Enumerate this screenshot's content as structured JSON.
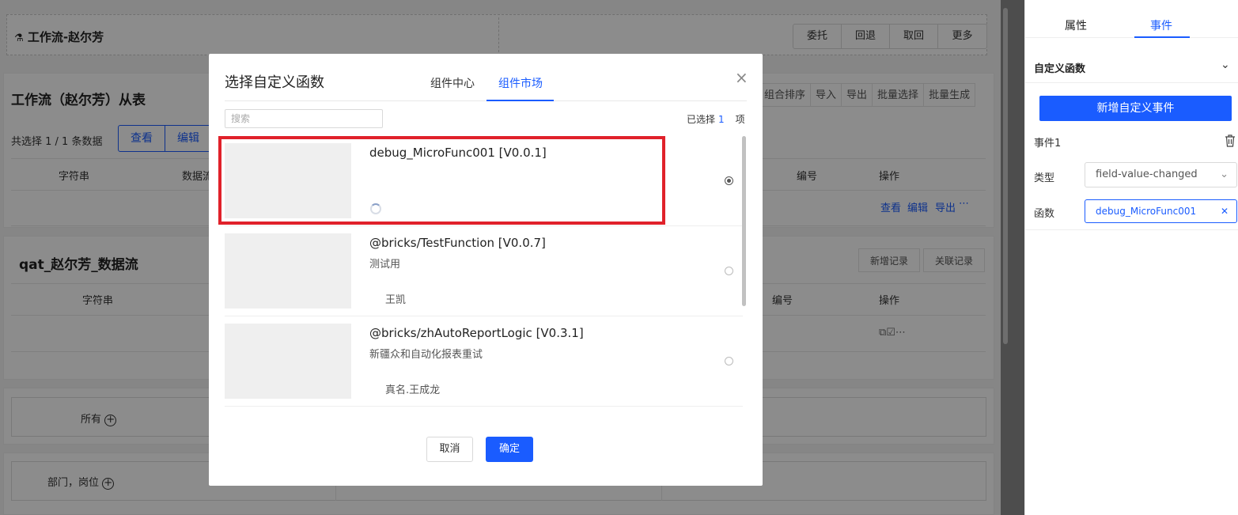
{
  "background": {
    "workflow_title": "工作流-赵尔芳",
    "workflow_buttons": [
      "委托",
      "回退",
      "取回",
      "更多"
    ],
    "section1": {
      "title": "工作流（赵尔芳）从表",
      "selected_text": "共选择 1 / 1 条数据",
      "action_buttons": [
        "查看",
        "编辑"
      ],
      "toolbar": [
        "组合排序",
        "导入",
        "导出",
        "批量选择",
        "批量生成"
      ],
      "columns_left": [
        "字符串",
        "数据流"
      ],
      "columns_right": [
        "编号",
        "操作"
      ],
      "row_actions": [
        "查看",
        "编辑",
        "导出",
        "⋯"
      ]
    },
    "section2": {
      "title": "qat_赵尔芳_数据流",
      "toolbar": [
        "新增记录",
        "关联记录"
      ],
      "columns_left": [
        "字符串"
      ],
      "columns_right": [
        "编号",
        "操作"
      ],
      "row_icons": "⧉☑⋯"
    },
    "filter1": "所有",
    "filter2": "部门，岗位"
  },
  "right_panel": {
    "tabs": [
      "属性",
      "事件"
    ],
    "active_tab": "事件",
    "section_title": "自定义函数",
    "add_button": "新增自定义事件",
    "event_name": "事件1",
    "type_label": "类型",
    "type_value": "field-value-changed",
    "func_label": "函数",
    "func_value": "debug_MicroFunc001"
  },
  "modal": {
    "title": "选择自定义函数",
    "tabs": [
      "组件中心",
      "组件市场"
    ],
    "active_tab": "组件市场",
    "search_placeholder": "搜索",
    "selected_prefix": "已选择",
    "selected_count": "1",
    "selected_suffix": "项",
    "items": [
      {
        "name": "debug_MicroFunc001 [V0.0.1]",
        "desc": "",
        "author": "",
        "selected": true,
        "loading": true
      },
      {
        "name": "@bricks/TestFunction [V0.0.7]",
        "desc": "测试用",
        "author": "王凯",
        "selected": false
      },
      {
        "name": "@bricks/zhAutoReportLogic [V0.3.1]",
        "desc": "新疆众和自动化报表重试",
        "author": "真名.王成龙",
        "selected": false
      }
    ],
    "cancel_label": "取消",
    "ok_label": "确定"
  }
}
